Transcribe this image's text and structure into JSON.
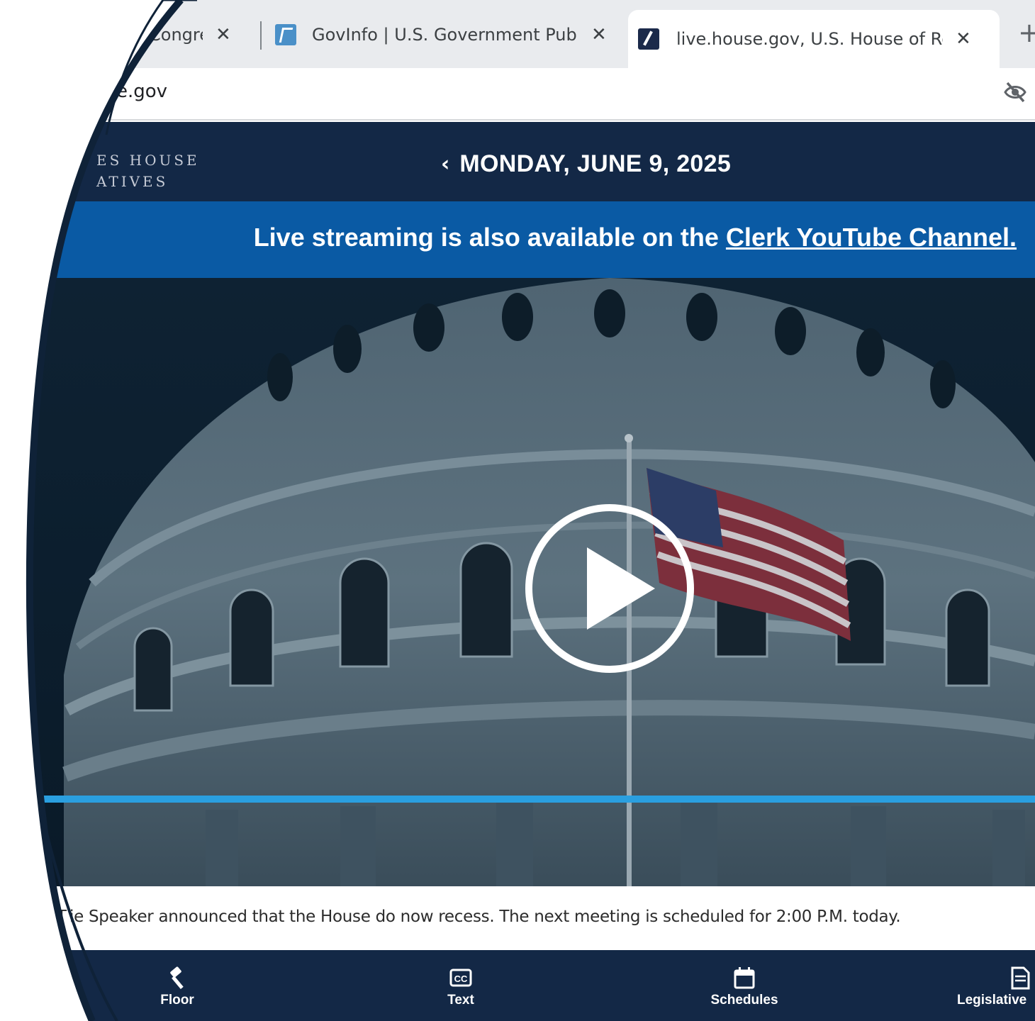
{
  "browser": {
    "tabs": [
      {
        "title": "Congres",
        "favicon": "congress-icon",
        "active": false
      },
      {
        "title": "GovInfo | U.S. Government Publis",
        "favicon": "govinfo-icon",
        "active": false
      },
      {
        "title": "live.house.gov, U.S. House of Repr",
        "favicon": "house-icon",
        "active": true
      }
    ],
    "close_glyph": "✕",
    "new_tab_glyph": "+",
    "url": "e.gov"
  },
  "header": {
    "logo_line1": "ES HOUSE",
    "logo_line2": "ATIVES",
    "prev_glyph": "‹",
    "date": "MONDAY, JUNE 9, 2025"
  },
  "banner": {
    "text": "Live streaming is also available on the ",
    "link": "Clerk YouTube Channel."
  },
  "video": {
    "play_icon": "play-button-icon"
  },
  "status": {
    "message": "T ie Speaker announced that the House do now recess. The next meeting is scheduled for 2:00 P.M. today."
  },
  "bottom_nav": [
    {
      "label": "Floor",
      "icon": "gavel-icon"
    },
    {
      "label": "Text",
      "icon": "cc-icon"
    },
    {
      "label": "Schedules",
      "icon": "calendar-icon"
    },
    {
      "label": "Legislative",
      "icon": "document-icon"
    }
  ],
  "colors": {
    "header_bg": "#132846",
    "banner_bg": "#0a5aa4",
    "progress": "#2a9fe0"
  }
}
